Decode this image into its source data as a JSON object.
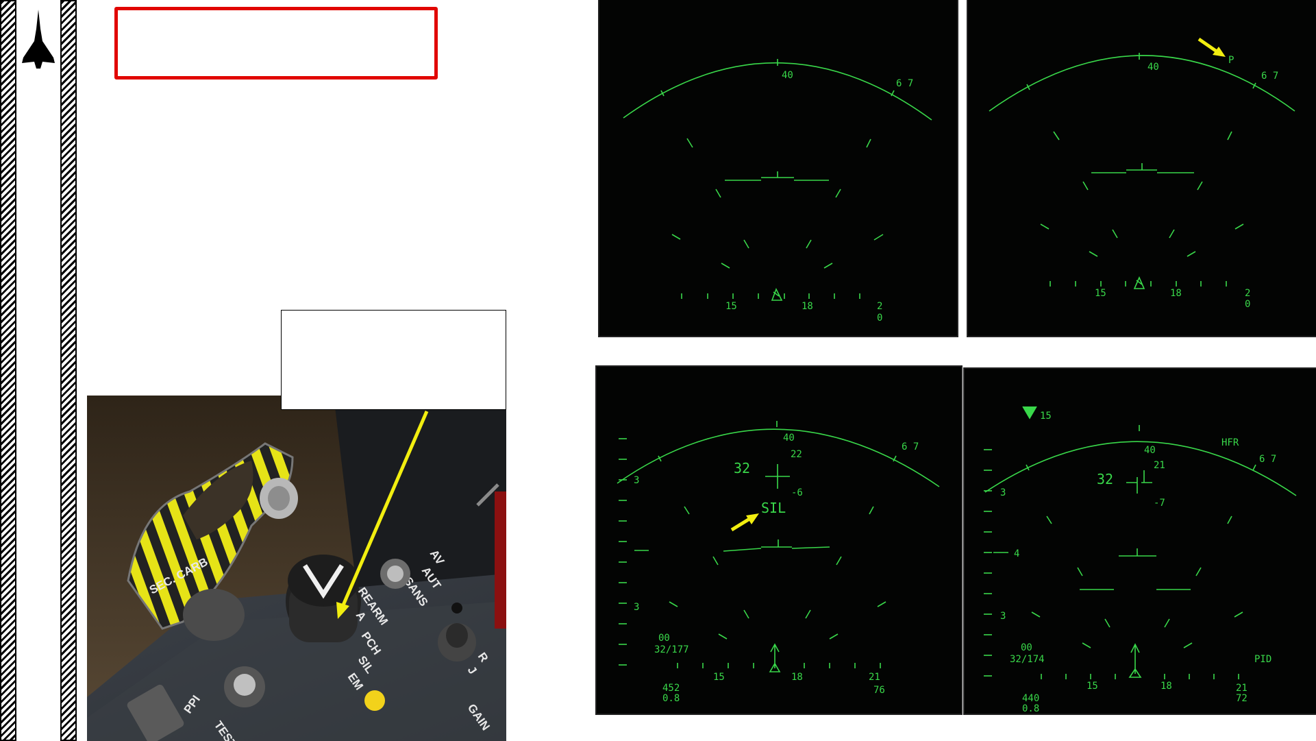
{
  "colors": {
    "hud_green": "#39d84a",
    "highlight_red": "#e10600",
    "arrow_yellow": "#f2ee10"
  },
  "cockpit": {
    "cover_label": "SEC. CARB",
    "knob_labels": [
      "REARM",
      "A",
      "PCH",
      "SIL",
      "EM"
    ],
    "left_labels": [
      "PPI",
      "TEST"
    ],
    "mode_labels": [
      "AV",
      "AUT",
      "SANS"
    ],
    "right_labels": [
      "R",
      "J"
    ],
    "gain_label": "GAIN"
  },
  "hud1": {
    "heading_top": "40",
    "scale_right": "6 7",
    "ticks": [
      "15",
      "18",
      "2",
      "0"
    ]
  },
  "hud2": {
    "marker": "P",
    "heading_top": "40",
    "scale_right": "6 7",
    "ticks": [
      "15",
      "18",
      "2",
      "0"
    ]
  },
  "hud3": {
    "heading_top": "40",
    "scale_right": "6 7",
    "left_num": "32",
    "top_right_num": "22",
    "lower_num": "-6",
    "mode_text": "SIL",
    "side_3a": "3",
    "side_3b": "3",
    "range_a": "00",
    "range_b": "32/177",
    "ticks": [
      "15",
      "18",
      "21"
    ],
    "bottom_left_a": "452",
    "bottom_left_b": "0.8",
    "bottom_right": "76"
  },
  "hud4": {
    "top_left_symbol": "V",
    "top_left_num": "15",
    "heading_top": "40",
    "hfr": "HFR",
    "scale_right": "6 7",
    "left_num": "32",
    "top_right_num": "21",
    "lower_num": "-7",
    "side_3a": "3",
    "side_4": "4",
    "side_3b": "3",
    "range_a": "00",
    "range_b": "32/174",
    "pid": "PID",
    "ticks": [
      "15",
      "18",
      "21"
    ],
    "bottom_left_a": "440",
    "bottom_left_b": "0.8",
    "bottom_right": "72"
  }
}
